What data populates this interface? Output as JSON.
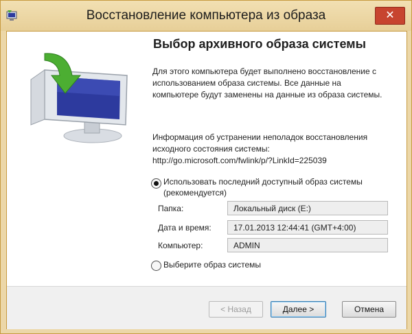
{
  "window": {
    "title": "Восстановление компьютера из образа",
    "close_glyph": "✕"
  },
  "page": {
    "heading": "Выбор архивного образа системы",
    "description": "Для этого компьютера будет выполнено восстановление с использованием образа системы. Все данные на компьютере будут заменены на данные из образа системы.",
    "info_text": "Информация об устранении неполадок восстановления исходного состояния системы:",
    "info_link": "http://go.microsoft.com/fwlink/p/?LinkId=225039"
  },
  "options": {
    "latest_label_line1": "Использовать последний доступный образ системы",
    "latest_label_line2": "(рекомендуется)",
    "latest_selected": true,
    "choose_label": "Выберите образ системы",
    "choose_selected": false
  },
  "image_details": {
    "folder_label": "Папка:",
    "folder_value": "Локальный диск (E:)",
    "datetime_label": "Дата и время:",
    "datetime_value": "17.01.2013 12:44:41 (GMT+4:00)",
    "computer_label": "Компьютер:",
    "computer_value": "ADMIN"
  },
  "buttons": {
    "back": "< Назад",
    "next": "Далее >",
    "cancel": "Отмена"
  },
  "icons": {
    "app": "restore-app-icon",
    "illustration": "monitor-restore-arrow-icon"
  },
  "colors": {
    "frame": "#ecd7a8",
    "close": "#c7442f",
    "arrow": "#4cae32",
    "screen": "#2d3a9e"
  }
}
